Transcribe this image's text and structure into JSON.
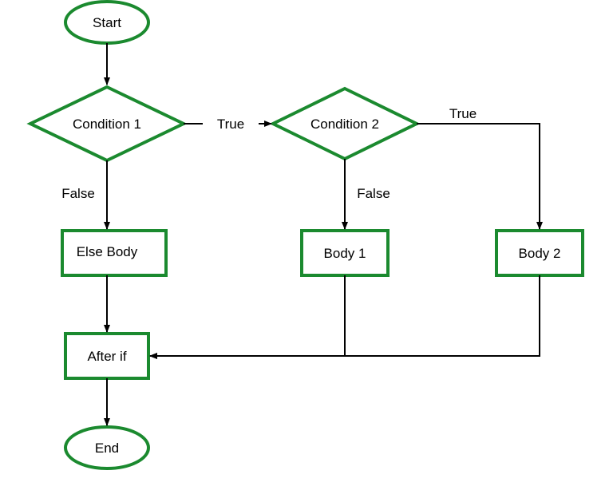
{
  "flowchart": {
    "nodes": {
      "start": {
        "label": "Start",
        "type": "terminator"
      },
      "cond1": {
        "label": "Condition 1",
        "type": "decision"
      },
      "cond2": {
        "label": "Condition 2",
        "type": "decision"
      },
      "elseBody": {
        "label": "Else Body",
        "type": "process"
      },
      "body1": {
        "label": "Body 1",
        "type": "process"
      },
      "body2": {
        "label": "Body 2",
        "type": "process"
      },
      "afterIf": {
        "label": "After if",
        "type": "process"
      },
      "end": {
        "label": "End",
        "type": "terminator"
      }
    },
    "edges": {
      "c1_true": {
        "label": "True"
      },
      "c1_false": {
        "label": "False"
      },
      "c2_true": {
        "label": "True"
      },
      "c2_false": {
        "label": "False"
      }
    }
  }
}
